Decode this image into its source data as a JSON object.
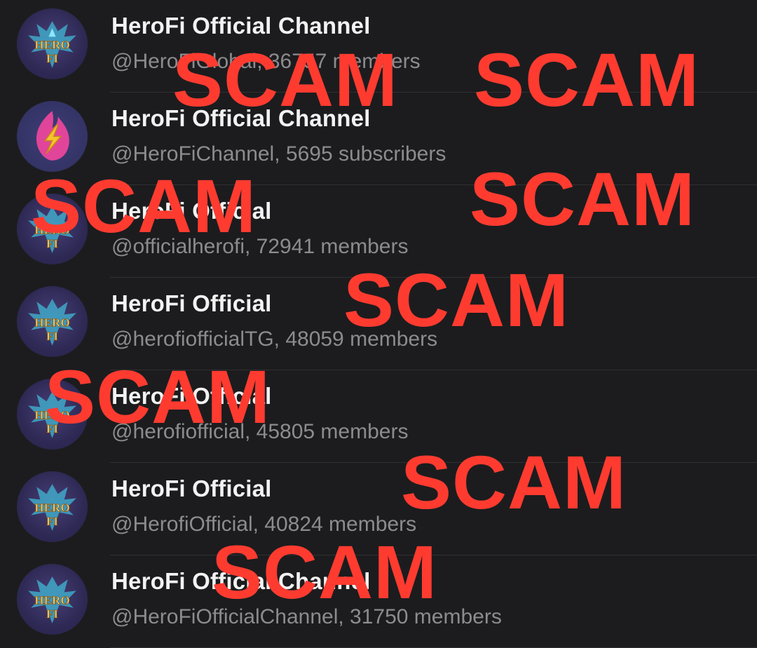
{
  "channels": [
    {
      "title": "HeroFi Official Channel",
      "subtitle": "@HeroFiGlobal, 36757 members",
      "avatar_icon": "herofi-logo-icon"
    },
    {
      "title": "HeroFi Official Channel",
      "subtitle": "@HeroFiChannel, 5695 subscribers",
      "avatar_icon": "lightning-bolt-icon"
    },
    {
      "title": "HeroFi Official",
      "subtitle": "@officialherofi, 72941 members",
      "avatar_icon": "herofi-logo-icon"
    },
    {
      "title": "HeroFi Official",
      "subtitle": "@herofiofficialTG, 48059 members",
      "avatar_icon": "herofi-logo-icon"
    },
    {
      "title": "HeroFi Official",
      "subtitle": "@herofiofficial, 45805 members",
      "avatar_icon": "herofi-logo-icon"
    },
    {
      "title": "HeroFi Official",
      "subtitle": "@HerofiOfficial, 40824 members",
      "avatar_icon": "herofi-logo-icon"
    },
    {
      "title": "HeroFi Official Channel",
      "subtitle": "@HeroFiOfficialChannel, 31750 members",
      "avatar_icon": "herofi-logo-icon"
    }
  ],
  "overlay": {
    "label": "SCAM",
    "color": "#ff3b30"
  },
  "logo_text": {
    "line1": "HERO",
    "line2": "FI"
  }
}
